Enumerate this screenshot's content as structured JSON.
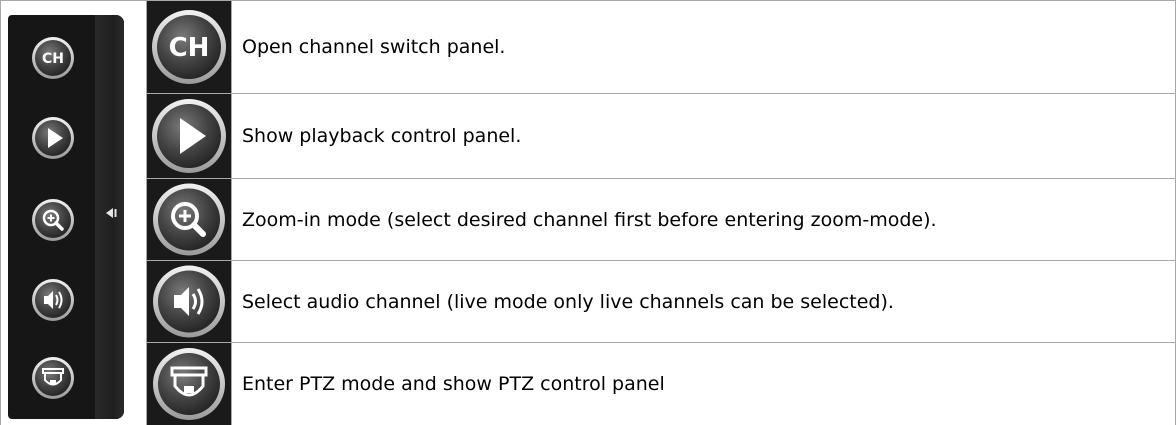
{
  "toolbar": {
    "buttons": [
      {
        "icon": "channel-icon",
        "label": "CH"
      },
      {
        "icon": "play-icon"
      },
      {
        "icon": "zoom-in-icon"
      },
      {
        "icon": "audio-icon"
      },
      {
        "icon": "ptz-camera-icon"
      }
    ],
    "collapse_icon": "collapse-arrow-icon"
  },
  "rows": [
    {
      "icon": "channel-icon",
      "icon_label": "CH",
      "description": "Open channel switch panel."
    },
    {
      "icon": "play-icon",
      "description": "Show playback control panel."
    },
    {
      "icon": "zoom-in-icon",
      "description": "Zoom-in mode (select desired channel first before entering zoom-mode)."
    },
    {
      "icon": "audio-icon",
      "description": "Select audio channel (live mode only live channels can be selected)."
    },
    {
      "icon": "ptz-camera-icon",
      "description": "Enter PTZ mode and show PTZ control panel"
    }
  ],
  "colors": {
    "grid": "#a8a8a8",
    "panel": "#161616",
    "button_fill": "#4a4a4a",
    "button_ring": "#d8d8d8"
  }
}
